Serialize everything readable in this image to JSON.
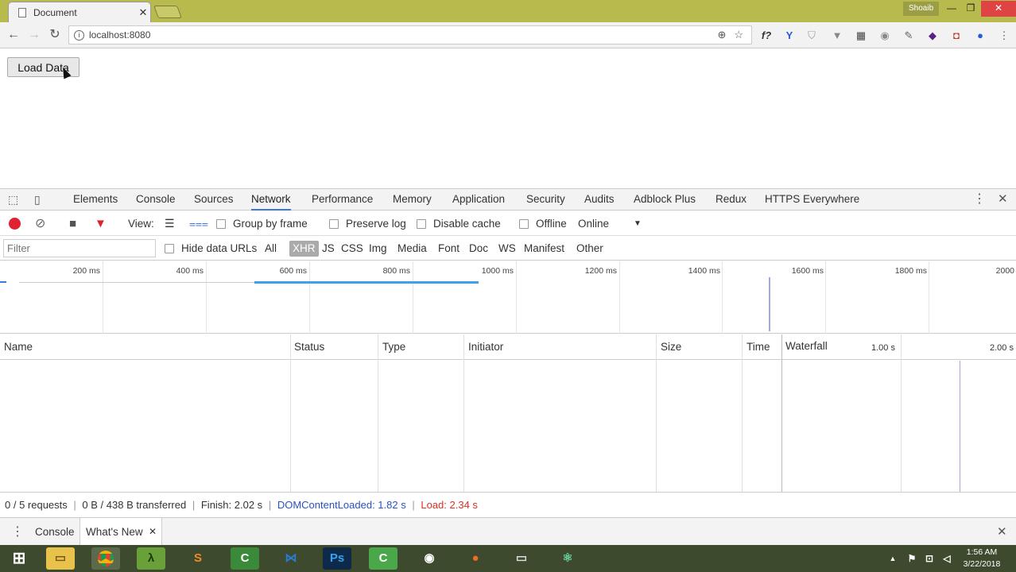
{
  "browser": {
    "tab_title": "Document",
    "tab_close": "✕",
    "user_name": "Shoaib",
    "url": "localhost:8080"
  },
  "page": {
    "load_button": "Load Data"
  },
  "devtools": {
    "tabs": [
      "Elements",
      "Console",
      "Sources",
      "Network",
      "Performance",
      "Memory",
      "Application",
      "Security",
      "Audits",
      "Adblock Plus",
      "Redux",
      "HTTPS Everywhere"
    ],
    "active_tab": "Network",
    "toolbar": {
      "view_label": "View:",
      "group_by_frame": "Group by frame",
      "preserve_log": "Preserve log",
      "disable_cache": "Disable cache",
      "offline": "Offline",
      "throttle": "Online"
    },
    "filter": {
      "placeholder": "Filter",
      "hide_data_urls": "Hide data URLs",
      "types": [
        "All",
        "XHR",
        "JS",
        "CSS",
        "Img",
        "Media",
        "Font",
        "Doc",
        "WS",
        "Manifest",
        "Other"
      ],
      "active_type": "XHR"
    },
    "overview_ticks": [
      "200 ms",
      "400 ms",
      "600 ms",
      "800 ms",
      "1000 ms",
      "1200 ms",
      "1400 ms",
      "1600 ms",
      "1800 ms",
      "2000"
    ],
    "columns": [
      "Name",
      "Status",
      "Type",
      "Initiator",
      "Size",
      "Time",
      "Waterfall"
    ],
    "waterfall_ticks": [
      "1.00 s",
      "2.00 s"
    ],
    "status": {
      "requests": "0 / 5 requests",
      "transferred": "0 B / 438 B transferred",
      "finish": "Finish: 2.02 s",
      "dom_content_loaded": "DOMContentLoaded: 1.82 s",
      "load": "Load: 2.34 s",
      "dom_color": "#2a52be",
      "load_color": "#d93025"
    },
    "drawer": {
      "tabs": [
        "Console",
        "What's New"
      ],
      "close": "✕"
    }
  },
  "taskbar": {
    "time": "1:56 AM",
    "date": "3/22/2018"
  }
}
